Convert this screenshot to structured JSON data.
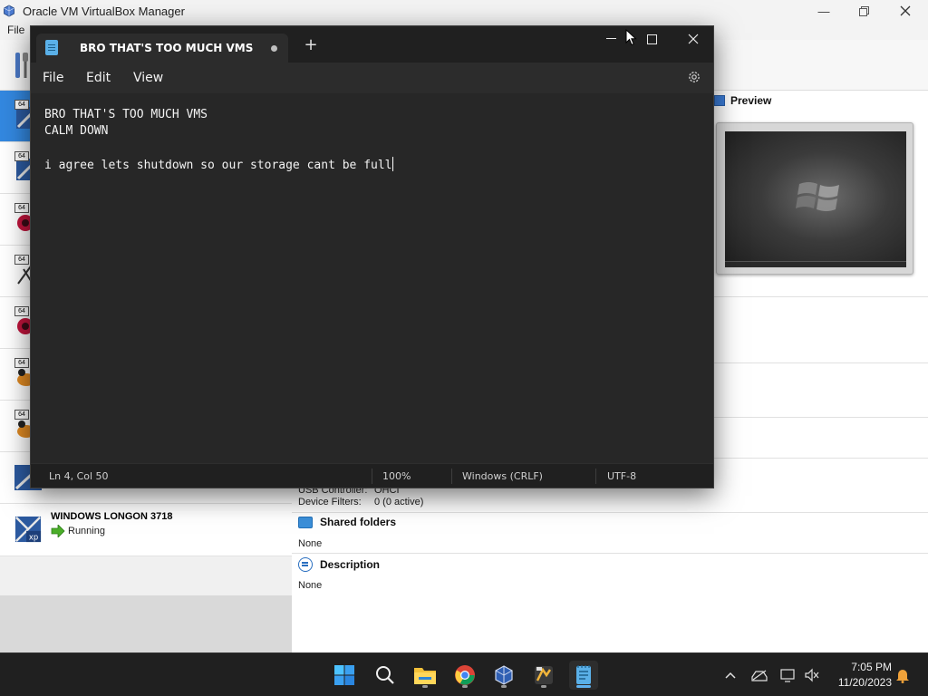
{
  "vbox": {
    "window_title": "Oracle VM VirtualBox Manager",
    "menu_file": "File",
    "vm_items": [
      {
        "badge": "64",
        "selected": true
      },
      {
        "badge": "64"
      },
      {
        "badge": "64"
      },
      {
        "badge": "64"
      },
      {
        "badge": "64"
      },
      {
        "badge": "64"
      },
      {
        "badge": "64"
      },
      {
        "badge": ""
      },
      {
        "name": "WINDOWS LONGON 3718",
        "status": "Running",
        "os_label": "xp"
      }
    ],
    "preview_label": "Preview",
    "usb_controller_label": "USB Controller:",
    "usb_controller_value": "OHCI",
    "device_filters_label": "Device Filters:",
    "device_filters_value": "0 (0 active)",
    "shared_folders_label": "Shared folders",
    "shared_folders_value": "None",
    "description_label": "Description",
    "description_value": "None"
  },
  "notepad": {
    "tab_title": "BRO THAT'S TOO MUCH VMS",
    "menu": [
      "File",
      "Edit",
      "View"
    ],
    "lines": [
      "BRO THAT'S TOO MUCH VMS",
      "CALM DOWN",
      "",
      "i agree lets shutdown so our storage cant be full"
    ],
    "status": {
      "position": "Ln 4, Col 50",
      "zoom": "100%",
      "line_ending": "Windows (CRLF)",
      "encoding": "UTF-8"
    }
  },
  "taskbar": {
    "apps": [
      "start-icon",
      "search-icon",
      "file-explorer-icon",
      "chrome-icon",
      "virtualbox-icon",
      "wallet-app-icon",
      "notepad-icon"
    ],
    "time": "7:05 PM",
    "date": "11/20/2023"
  },
  "colors": {
    "notepad_bg": "#272727",
    "vm_selected": "#3388e0",
    "taskbar_bg": "#202020",
    "accent": "#5fb2f0"
  }
}
